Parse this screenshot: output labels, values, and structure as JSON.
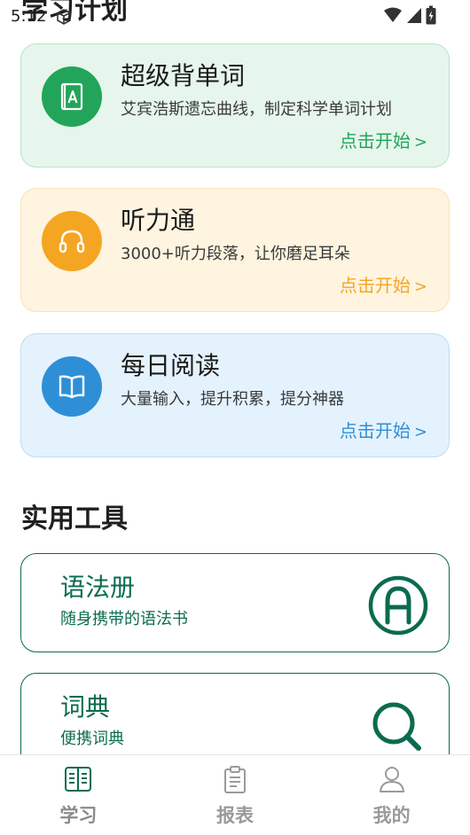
{
  "status_bar": {
    "time": "5:12",
    "icons": [
      "package-icon",
      "wifi-icon",
      "signal-icon",
      "battery-icon"
    ]
  },
  "sections": {
    "plan_title": "学习计划",
    "tools_title": "实用工具"
  },
  "plan_cards": [
    {
      "title": "超级背单词",
      "description": "艾宾浩斯遗忘曲线，制定科学单词计划",
      "start": "点击开始",
      "arrow": ">",
      "icon": "vocab-book-icon",
      "color": "#22a55a"
    },
    {
      "title": "听力通",
      "description": "3000+听力段落，让你磨足耳朵",
      "start": "点击开始",
      "arrow": ">",
      "icon": "headphones-icon",
      "color": "#f4a623"
    },
    {
      "title": "每日阅读",
      "description": "大量输入，提升积累，提分神器",
      "start": "点击开始",
      "arrow": ">",
      "icon": "open-book-icon",
      "color": "#2f8fd6"
    }
  ],
  "tool_cards": [
    {
      "title": "语法册",
      "description": "随身携带的语法书",
      "icon": "grammar-a-icon"
    },
    {
      "title": "词典",
      "description": "便携词典",
      "icon": "search-icon"
    }
  ],
  "bottom_nav": {
    "items": [
      {
        "label": "学习",
        "icon": "book-icon",
        "active": true
      },
      {
        "label": "报表",
        "icon": "clipboard-icon",
        "active": false
      },
      {
        "label": "我的",
        "icon": "profile-icon",
        "active": false
      }
    ]
  },
  "colors": {
    "accent_green": "#22a55a",
    "accent_orange": "#f4a623",
    "accent_blue": "#2f8fd6",
    "tool_green": "#0b6b4f"
  }
}
